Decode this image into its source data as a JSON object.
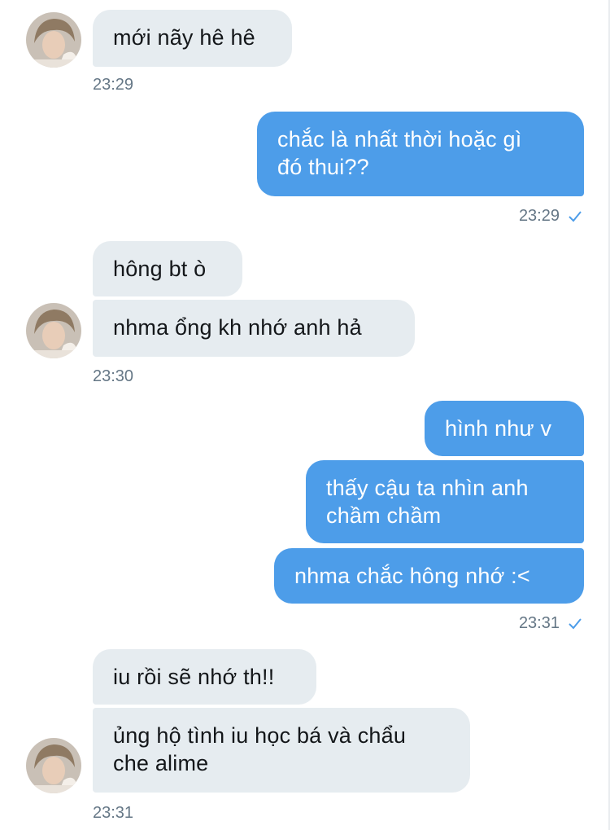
{
  "colors": {
    "incoming_bubble": "#e6ecf0",
    "outgoing_bubble": "#4d9de9",
    "timestamp": "#657786",
    "read_check": "#4d9de9"
  },
  "icons": {
    "avatar": "avatar-photo",
    "read_receipt": "check-icon"
  },
  "messages": [
    {
      "id": "m1",
      "direction": "incoming",
      "lines": [
        "mới nãy hê hê"
      ]
    },
    {
      "id": "t1",
      "kind": "timestamp",
      "text": "23:29"
    },
    {
      "id": "m2",
      "direction": "outgoing",
      "lines": [
        "chắc là nhất thời hoặc gì",
        "đó thui??"
      ]
    },
    {
      "id": "t2",
      "kind": "timestamp",
      "text": "23:29",
      "read": true
    },
    {
      "id": "m3",
      "direction": "incoming",
      "lines": [
        "hông bt ò"
      ]
    },
    {
      "id": "m4",
      "direction": "incoming",
      "lines": [
        "nhma ổng kh nhớ anh hả"
      ]
    },
    {
      "id": "t3",
      "kind": "timestamp",
      "text": "23:30"
    },
    {
      "id": "m5",
      "direction": "outgoing",
      "lines": [
        "hình như v"
      ]
    },
    {
      "id": "m6",
      "direction": "outgoing",
      "lines": [
        "thấy cậu ta nhìn anh",
        "chầm chầm"
      ]
    },
    {
      "id": "m7",
      "direction": "outgoing",
      "lines": [
        "nhma chắc hông nhớ :<"
      ]
    },
    {
      "id": "t4",
      "kind": "timestamp",
      "text": "23:31",
      "read": true
    },
    {
      "id": "m8",
      "direction": "incoming",
      "lines": [
        "iu rồi sẽ nhớ th!!"
      ]
    },
    {
      "id": "m9",
      "direction": "incoming",
      "lines": [
        "ủng hộ tình iu học bá và chẩu",
        "che alime"
      ]
    },
    {
      "id": "t5",
      "kind": "timestamp",
      "text": "23:31"
    }
  ]
}
